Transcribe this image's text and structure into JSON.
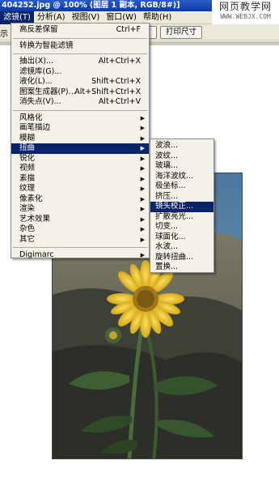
{
  "window": {
    "title": "404252.jpg @ 100% (图层 1 副本, RGB/8#)]"
  },
  "watermark": {
    "line1": "网页教学网",
    "line2": "WWW.WEBJX.COM"
  },
  "menubar": {
    "items": [
      "滤镜(T)",
      "分析(A)",
      "视图(V)",
      "窗口(W)",
      "帮助(H)"
    ]
  },
  "optionbar": {
    "left_label": "示",
    "print_size_label": "打印尺寸"
  },
  "filter_menu": {
    "last_filter": {
      "label": "高反差保留",
      "shortcut": "Ctrl+F"
    },
    "convert_smart": "转换为智能滤镜",
    "group1": [
      {
        "label": "抽出(X)...",
        "shortcut": "Alt+Ctrl+X"
      },
      {
        "label": "滤镜库(G)...",
        "shortcut": ""
      },
      {
        "label": "液化(L)...",
        "shortcut": "Shift+Ctrl+X"
      },
      {
        "label": "图案生成器(P)...",
        "shortcut": "Alt+Shift+Ctrl+X"
      },
      {
        "label": "消失点(V)...",
        "shortcut": "Alt+Ctrl+V"
      }
    ],
    "group2": [
      "风格化",
      "画笔描边",
      "模糊",
      "扭曲",
      "锐化",
      "视频",
      "素描",
      "纹理",
      "像素化",
      "渲染",
      "艺术效果",
      "杂色",
      "其它"
    ],
    "digimarc": "Digimarc"
  },
  "distort_submenu": {
    "items": [
      "波浪...",
      "波纹...",
      "玻璃...",
      "海洋波纹...",
      "极坐标...",
      "挤压...",
      "镜头校正...",
      "扩散亮光...",
      "切变...",
      "球面化...",
      "水波...",
      "旋转扭曲...",
      "置换..."
    ],
    "highlighted": "镜头校正..."
  },
  "colors": {
    "menu_highlight": "#0a246a",
    "menu_bg": "#f4f2e8",
    "toolbar_bg": "#ece9d8",
    "titlebar": "#0a3aa6"
  }
}
